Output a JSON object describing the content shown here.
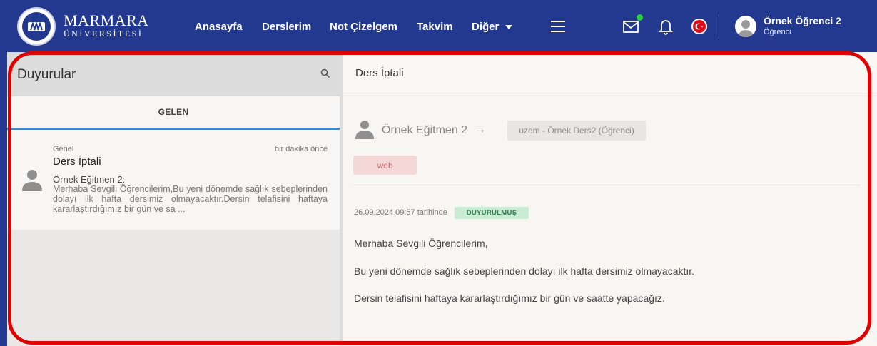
{
  "brand": {
    "name": "MARMARA",
    "sub": "ÜNİVERSİTESİ",
    "seal_text": "MARMARA ÜNİVERSİTESİ 1883"
  },
  "nav": {
    "home": "Anasayfa",
    "courses": "Derslerim",
    "grades": "Not Çizelgem",
    "calendar": "Takvim",
    "more": "Diğer"
  },
  "user": {
    "name": "Örnek Öğrenci 2",
    "role": "Öğrenci"
  },
  "announcements": {
    "title": "Duyurular",
    "tab_incoming": "GELEN",
    "items": [
      {
        "category": "Genel",
        "time": "bir dakika önce",
        "title": "Ders İptali",
        "sender": "Örnek Eğitmen 2:",
        "preview": "Merhaba Sevgili Öğrencilerim,Bu yeni dönemde sağlık sebeplerinden dolayı ilk hafta dersimiz olmayacaktır.Dersin telafisini haftaya kararlaştırdığımız bir gün ve sa ..."
      }
    ]
  },
  "detail": {
    "title": "Ders İptali",
    "instructor": "Örnek Eğitmen 2",
    "arrow": "→",
    "course": "uzem - Örnek Ders2 (Öğrenci)",
    "tag": "web",
    "date_text": "26.09.2024 09:57 tarihinde",
    "status": "DUYURULMUŞ",
    "body": [
      "Merhaba Sevgili Öğrencilerim,",
      "Bu yeni dönemde sağlık sebeplerinden dolayı ilk hafta dersimiz olmayacaktır.",
      "Dersin telafisini haftaya kararlaştırdığımız bir gün ve saatte yapacağız."
    ]
  },
  "colors": {
    "navbar": "#23398f",
    "highlight": "#e00000",
    "tab_underline": "#2d8fdc",
    "status_bg": "#c9ead3",
    "tag_bg": "#f4d7d7"
  }
}
